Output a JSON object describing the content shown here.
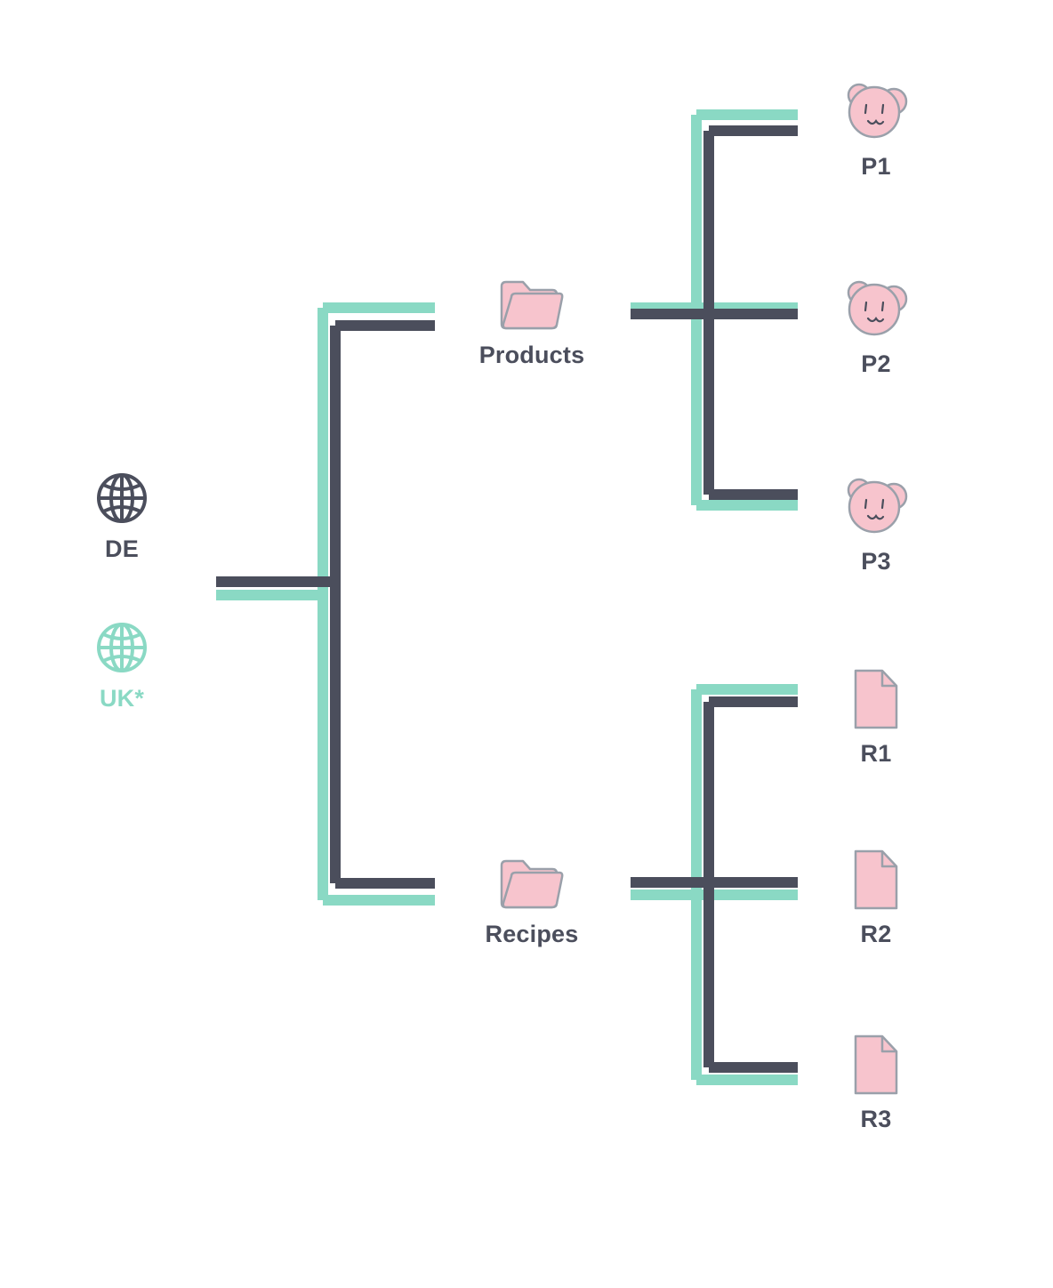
{
  "diagram": {
    "type": "tree",
    "title": "",
    "colors": {
      "line_dark": "#4b4e5c",
      "line_green": "#8ad9c4",
      "icon_fill_pink": "#f7c4cd",
      "icon_stroke_gray": "#9aa0aa",
      "label_dark": "#4b4e5c",
      "label_green": "#8ad9c4",
      "background": "#ffffff"
    },
    "roots": [
      {
        "id": "de",
        "label": "DE",
        "icon": "globe-icon",
        "color": "dark"
      },
      {
        "id": "uk",
        "label": "UK*",
        "icon": "globe-icon",
        "color": "green"
      }
    ],
    "branches": [
      {
        "id": "products",
        "label": "Products",
        "icon": "folder-icon",
        "children": [
          {
            "id": "p1",
            "label": "P1",
            "icon": "pig-face-icon"
          },
          {
            "id": "p2",
            "label": "P2",
            "icon": "pig-face-icon"
          },
          {
            "id": "p3",
            "label": "P3",
            "icon": "pig-face-icon"
          }
        ]
      },
      {
        "id": "recipes",
        "label": "Recipes",
        "icon": "folder-icon",
        "children": [
          {
            "id": "r1",
            "label": "R1",
            "icon": "document-icon"
          },
          {
            "id": "r2",
            "label": "R2",
            "icon": "document-icon"
          },
          {
            "id": "r3",
            "label": "R3",
            "icon": "document-icon"
          }
        ]
      }
    ]
  }
}
